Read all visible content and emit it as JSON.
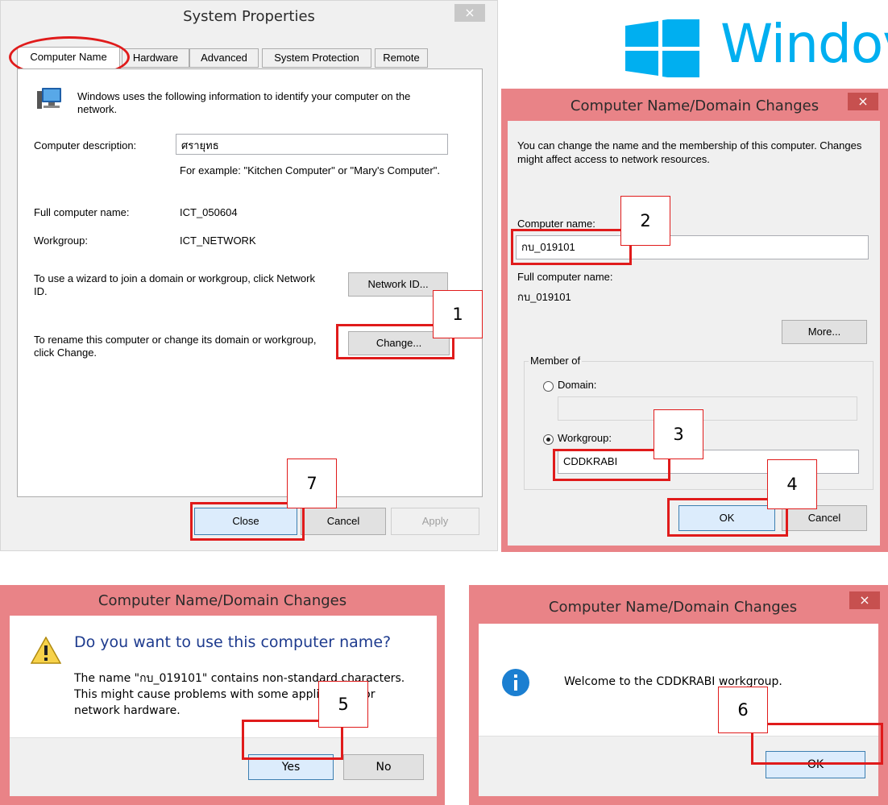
{
  "sys": {
    "title": "System Properties",
    "close": "×",
    "tabs": [
      "Computer Name",
      "Hardware",
      "Advanced",
      "System Protection",
      "Remote"
    ],
    "intro": "Windows uses the following information to identify your computer on the network.",
    "desc_label": "Computer description:",
    "desc_value": "ศรายุทธ",
    "example": "For example: \"Kitchen Computer\" or \"Mary's Computer\".",
    "full_label": "Full computer name:",
    "full_value": "ICT_050604",
    "wg_label": "Workgroup:",
    "wg_value": "ICT_NETWORK",
    "wizard_text": "To use a wizard to join a domain or workgroup, click Network ID.",
    "network_id": "Network ID...",
    "rename_text": "To rename this computer or change its domain or workgroup, click Change.",
    "change": "Change...",
    "close_btn": "Close",
    "cancel": "Cancel",
    "apply": "Apply"
  },
  "logo": {
    "text": "Windov",
    "color": "#00aff0"
  },
  "cn": {
    "title": "Computer Name/Domain Changes",
    "close": "×",
    "intro": "You can change the name and the membership of this computer. Changes might affect access to network resources.",
    "name_label": "Computer name:",
    "name_value": "กบ_019101",
    "full_label": "Full computer name:",
    "full_value": "กบ_019101",
    "more": "More...",
    "member_of": "Member of",
    "domain": "Domain:",
    "workgroup": "Workgroup:",
    "workgroup_value": "CDDKRABI",
    "ok": "OK",
    "cancel": "Cancel"
  },
  "confirm": {
    "title": "Computer Name/Domain Changes",
    "question": "Do you want to use this computer name?",
    "body": "The name \"กบ_019101\" contains non-standard characters. This might cause problems with some applications or network hardware.",
    "yes": "Yes",
    "no": "No"
  },
  "welcome": {
    "title": "Computer Name/Domain Changes",
    "close": "×",
    "message": "Welcome to the CDDKRABI workgroup.",
    "ok": "OK"
  },
  "steps": [
    "1",
    "2",
    "3",
    "4",
    "5",
    "6",
    "7"
  ],
  "colors": {
    "accent_frame": "#e98387",
    "close_red": "#c7504f",
    "highlight": "#e01b1b"
  }
}
